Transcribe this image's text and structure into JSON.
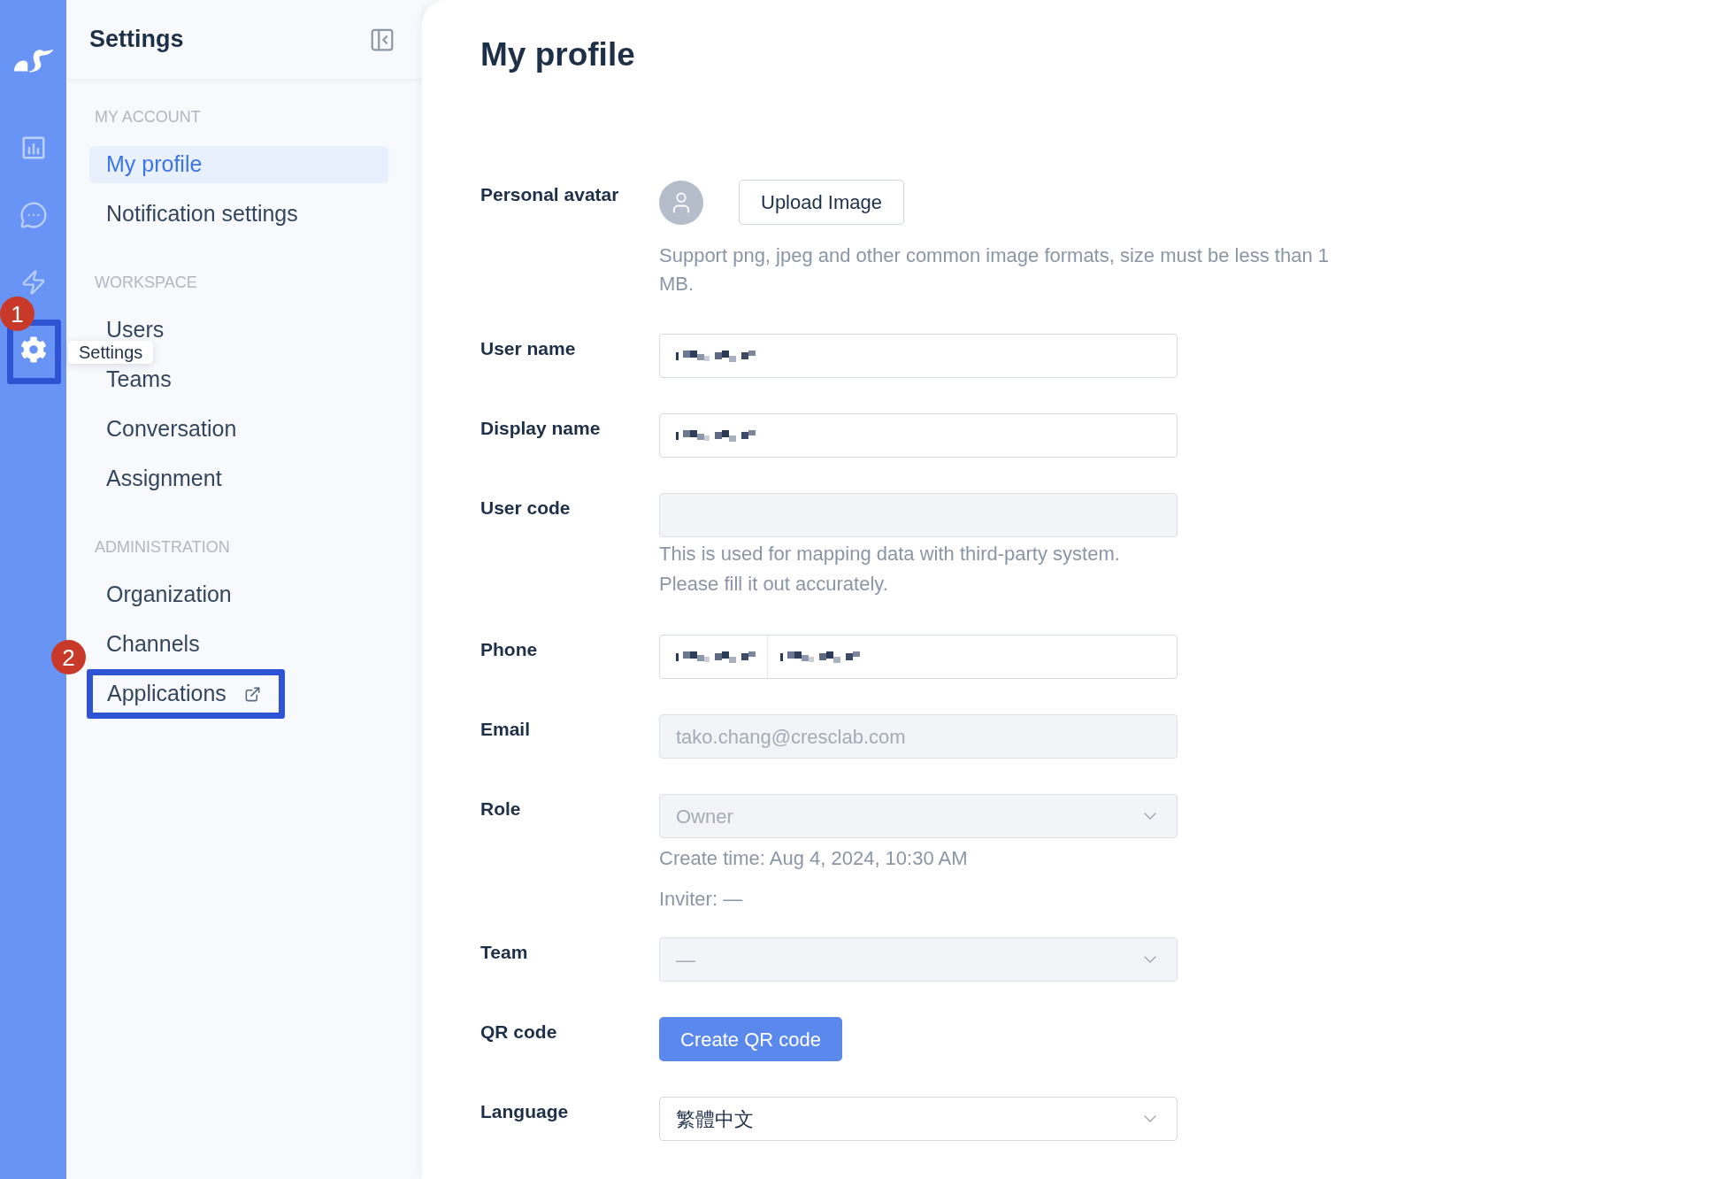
{
  "rail": {
    "items": [
      {
        "selected": false
      },
      {
        "selected": false
      },
      {
        "selected": false
      },
      {
        "selected": true,
        "callout": "1",
        "tooltip": "Settings"
      }
    ]
  },
  "sidebar": {
    "title": "Settings",
    "sections": [
      {
        "heading": "MY ACCOUNT",
        "items": [
          {
            "label": "My profile",
            "selected": true
          },
          {
            "label": "Notification settings",
            "selected": false
          }
        ]
      },
      {
        "heading": "WORKSPACE",
        "items": [
          {
            "label": "Users",
            "selected": false
          },
          {
            "label": "Teams",
            "selected": false
          },
          {
            "label": "Conversation",
            "selected": false
          },
          {
            "label": "Assignment",
            "selected": false
          }
        ]
      },
      {
        "heading": "ADMINISTRATION",
        "items": [
          {
            "label": "Organization",
            "selected": false
          },
          {
            "label": "Channels",
            "selected": false
          },
          {
            "label": "Applications",
            "selected": false,
            "external": true,
            "callout": "2"
          }
        ]
      }
    ]
  },
  "page": {
    "title": "My profile",
    "fields": [
      {
        "label": "Personal avatar",
        "kind": "avatar",
        "button": "Upload Image",
        "disabled": false,
        "help": [
          "Support png, jpeg and other common image formats, size must be less than 1 MB."
        ]
      },
      {
        "label": "User name",
        "kind": "text",
        "disabled": false,
        "redacted": true
      },
      {
        "label": "Display name",
        "kind": "text",
        "disabled": false,
        "redacted": true
      },
      {
        "label": "User code",
        "kind": "text",
        "disabled": true,
        "help": [
          "This is used for mapping data with third-party system. Please fill it out accurately."
        ]
      },
      {
        "label": "Phone",
        "kind": "phone",
        "disabled": false,
        "redacted": true
      },
      {
        "label": "Email",
        "kind": "text",
        "disabled": true,
        "value": "tako.chang@cresclab.com"
      },
      {
        "label": "Role",
        "kind": "select",
        "disabled": true,
        "value": "Owner",
        "help": [
          "Create time: Aug 4, 2024, 10:30 AM",
          "Inviter: —"
        ]
      },
      {
        "label": "Team",
        "kind": "select",
        "disabled": true,
        "value": "—"
      },
      {
        "label": "QR code",
        "kind": "button",
        "button": "Create QR code",
        "disabled": false
      },
      {
        "label": "Language",
        "kind": "select",
        "disabled": false,
        "value": "繁體中文"
      }
    ]
  }
}
